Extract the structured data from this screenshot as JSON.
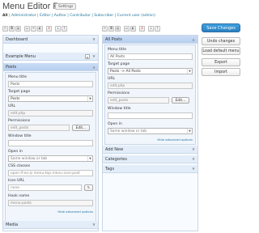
{
  "header": {
    "title": "Menu Editor Pro",
    "settings_label": "Settings"
  },
  "roles": {
    "all": "All",
    "list": " | Administrator | Editor | Author | Contributor | Subscriber | Current user (admin)"
  },
  "left_menu": {
    "items": [
      {
        "label": "Dashboard"
      },
      {
        "label": "Example Menu"
      },
      {
        "label": "Posts"
      },
      {
        "label": "Media"
      }
    ],
    "edit": {
      "menu_title_label": "Menu title",
      "menu_title_value": "Posts",
      "target_page_label": "Target page",
      "target_page_value": "Posts",
      "url_label": "URL",
      "url_value": "edit.php",
      "permissions_label": "Permissions",
      "permissions_value": "edit_posts",
      "edit_btn": "Edit...",
      "window_title_label": "Window title",
      "window_title_value": "",
      "open_in_label": "Open in",
      "open_in_value": "Same window or tab",
      "css_label": "CSS classes",
      "css_value": "open-if-no-js menu-top menu-icon-post",
      "icon_url_label": "Icon URL",
      "icon_url_value": "none",
      "hook_label": "Hook name",
      "hook_value": "menu-posts",
      "hide_link": "Hide advanced options"
    }
  },
  "right_menu": {
    "items": [
      {
        "label": "All Posts"
      },
      {
        "label": "Add New"
      },
      {
        "label": "Categories"
      },
      {
        "label": "Tags"
      }
    ],
    "edit": {
      "menu_title_label": "Menu title",
      "menu_title_value": "All Posts",
      "target_page_label": "Target page",
      "target_page_value": "Posts -> All Posts",
      "url_label": "URL",
      "url_value": "edit.php",
      "permissions_label": "Permissions",
      "permissions_value": "edit_posts",
      "edit_btn": "Edit...",
      "window_title_label": "Window title",
      "window_title_value": "",
      "open_in_label": "Open in",
      "open_in_value": "Same window or tab",
      "hide_link": "Hide advanced options"
    }
  },
  "actions": {
    "save": "Save Changes",
    "undo": "Undo changes",
    "load_default": "Load default menu",
    "export": "Export",
    "import": "Import"
  },
  "colors": {
    "accent": "#2a7fc0",
    "link": "#21759b",
    "panel_border": "#c9d7e8"
  }
}
